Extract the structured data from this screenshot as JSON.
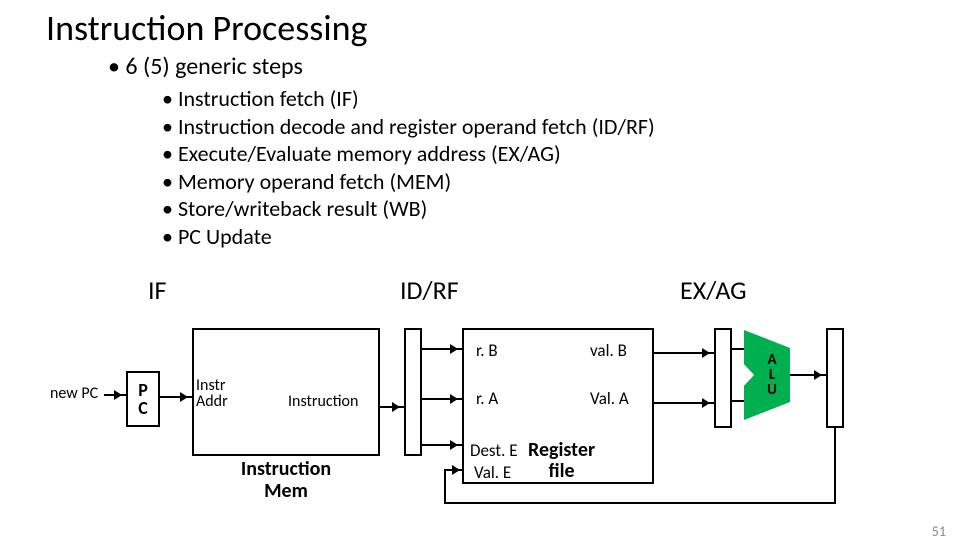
{
  "title": "Instruction Processing",
  "subtitle": "6 (5) generic steps",
  "steps": [
    "Instruction fetch (IF)",
    "Instruction decode and register operand fetch (ID/RF)",
    "Execute/Evaluate memory address (EX/AG)",
    "Memory operand fetch (MEM)",
    "Store/writeback result (WB)",
    "PC Update"
  ],
  "stages": {
    "if": "IF",
    "idrf": "ID/RF",
    "exag": "EX/AG"
  },
  "diagram": {
    "new_pc": "new PC",
    "pc": "P\nC",
    "imem_in": "Instr\nAddr",
    "imem_out": "Instruction",
    "imem_caption": "Instruction\nMem",
    "rf": {
      "rB": "r. B",
      "rA": "r. A",
      "DestE": "Dest. E",
      "ValE": "Val. E",
      "valB": "val. B",
      "ValA": "Val. A",
      "caption": "Register\nfile"
    },
    "alu": "A\nL\nU"
  },
  "page": "51"
}
